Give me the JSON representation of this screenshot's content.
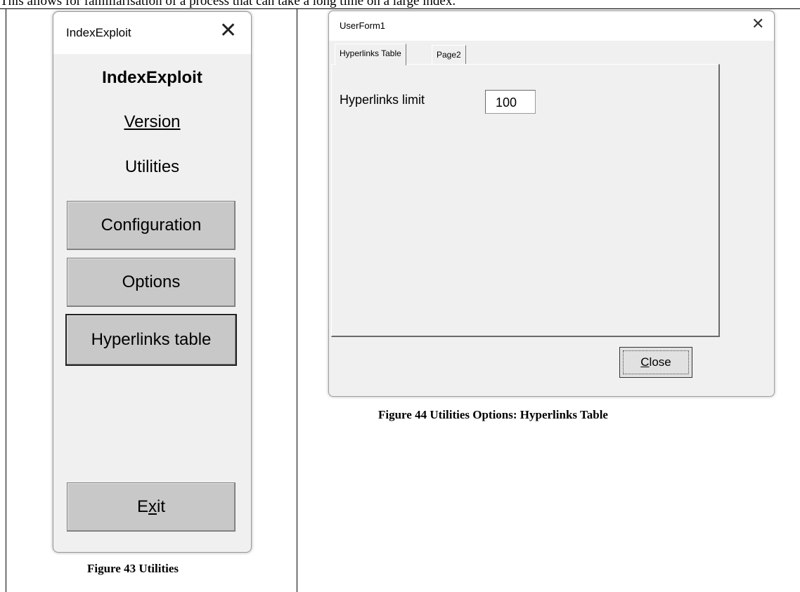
{
  "document": {
    "intro_text": "This allows for familiarisation of a process that can take a long time on a large index.",
    "left_caption": "Figure 43 Utilities",
    "right_caption": "Figure 44 Utilities Options: Hyperlinks Table"
  },
  "index_window": {
    "title": "IndexExploit",
    "close_glyph": "✕",
    "app_title": "IndexExploit",
    "version_link": "Version",
    "section_label": "Utilities",
    "buttons": {
      "configuration": "Configuration",
      "options": "Options",
      "hyperlinks_table": "Hyperlinks table",
      "exit_prefix": "E",
      "exit_accel": "x",
      "exit_suffix": "it"
    }
  },
  "userform": {
    "title": "UserForm1",
    "close_glyph": "✕",
    "tabs": [
      {
        "label": "Hyperlinks Table",
        "active": true
      },
      {
        "label": "Page2",
        "active": false
      }
    ],
    "hyperlinks_limit_label": "Hyperlinks limit",
    "hyperlinks_limit_value": "100",
    "close_button_accel": "C",
    "close_button_rest": "lose"
  }
}
